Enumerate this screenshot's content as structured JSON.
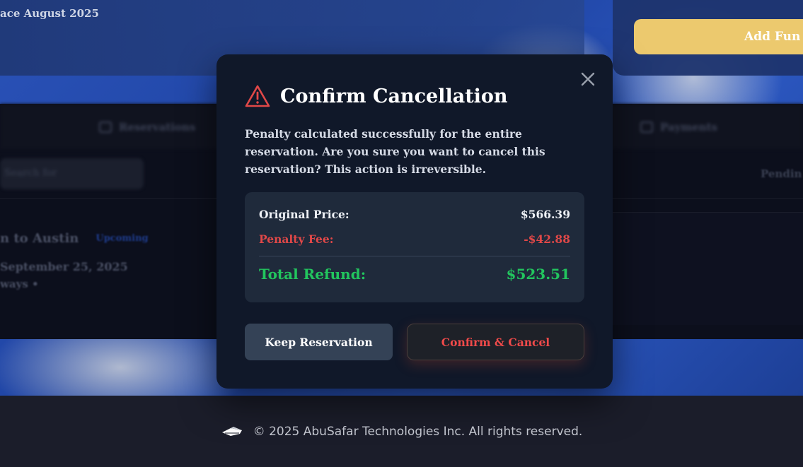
{
  "background": {
    "subtitle": "ace August 2025",
    "add_funds_label": "Add Fun",
    "nav": {
      "reservations": "Reservations",
      "payments": "Payments"
    },
    "search_placeholder": "Search for",
    "pending_label": "Pendin",
    "reservation": {
      "route": "n to Austin",
      "badge": "Upcoming",
      "date": "September 25, 2025",
      "airline": "ways  •"
    }
  },
  "modal": {
    "title": "Confirm Cancellation",
    "message": "Penalty calculated successfully for the entire reservation. Are you sure you want to cancel this reservation? This action is irreversible.",
    "summary": {
      "original_price_label": "Original Price:",
      "original_price_value": "$566.39",
      "penalty_label": "Penalty Fee:",
      "penalty_value": "-$42.88",
      "total_refund_label": "Total Refund:",
      "total_refund_value": "$523.51"
    },
    "keep_button": "Keep Reservation",
    "confirm_button": "Confirm & Cancel",
    "icons": {
      "warning": "warning-triangle-icon",
      "close": "close-icon"
    }
  },
  "footer": {
    "text": "© 2025 AbuSafar Technologies Inc. All rights reserved.",
    "logo_icon": "plane-logo-icon"
  },
  "colors": {
    "modal_bg": "#101829",
    "summary_bg": "#1f2a3b",
    "danger": "#e04848",
    "success": "#22c55e",
    "accent_gold": "#ecc96e"
  }
}
